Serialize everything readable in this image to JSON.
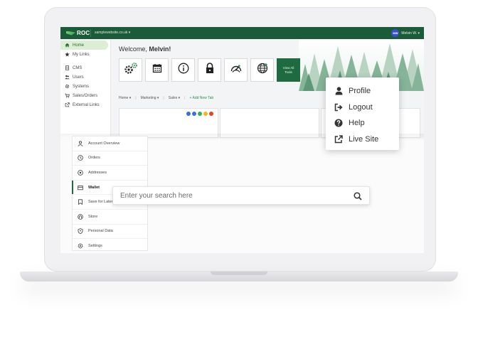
{
  "topbar": {
    "logo_text": "ROC",
    "site_selector": "samplewebsite.co.uk ▾",
    "user_initials": "MW",
    "user_name": "Melvin W. ▾"
  },
  "sidebar": {
    "items": [
      {
        "label": "Home",
        "icon": "home-icon"
      },
      {
        "label": "My Links",
        "icon": "star-icon"
      },
      {
        "label": "CMS",
        "icon": "document-icon"
      },
      {
        "label": "Users",
        "icon": "users-icon"
      },
      {
        "label": "Systems",
        "icon": "gear-icon"
      },
      {
        "label": "Sales/Orders",
        "icon": "cart-icon"
      },
      {
        "label": "External Links",
        "icon": "external-link-icon"
      }
    ]
  },
  "header": {
    "welcome_prefix": "Welcome,",
    "welcome_name": "Melvin!",
    "view_all_line1": "View All",
    "view_all_line2": "Tools"
  },
  "tabs": {
    "home": "Home ▾",
    "marketing": "Marketing ▾",
    "sales": "Sales ▾",
    "add": "+ Add New Tab",
    "separator": "|"
  },
  "status_dots": [
    "#3a6fd8",
    "#3a6fd8",
    "#33b05a",
    "#f0b429",
    "#e0452c"
  ],
  "account_menu": {
    "items": [
      {
        "label": "Account Overview",
        "icon": "person-icon"
      },
      {
        "label": "Orders",
        "icon": "clock-icon"
      },
      {
        "label": "Addresses",
        "icon": "location-pin-icon"
      },
      {
        "label": "Wallet",
        "icon": "wallet-icon"
      },
      {
        "label": "Save for Later",
        "icon": "bookmark-icon"
      },
      {
        "label": "Store",
        "icon": "store-icon"
      },
      {
        "label": "Personal Data",
        "icon": "shield-icon"
      },
      {
        "label": "Settings",
        "icon": "gear-icon"
      }
    ]
  },
  "search": {
    "placeholder": "Enter your search here"
  },
  "user_menu": {
    "items": [
      {
        "label": "Profile",
        "icon": "user-icon"
      },
      {
        "label": "Logout",
        "icon": "logout-icon"
      },
      {
        "label": "Help",
        "icon": "help-icon"
      },
      {
        "label": "Live Site",
        "icon": "external-link-icon"
      }
    ]
  },
  "colors": {
    "brand_green": "#1c5b3a",
    "accent_green": "#1f6a40",
    "active_bg": "#dcefd4"
  }
}
